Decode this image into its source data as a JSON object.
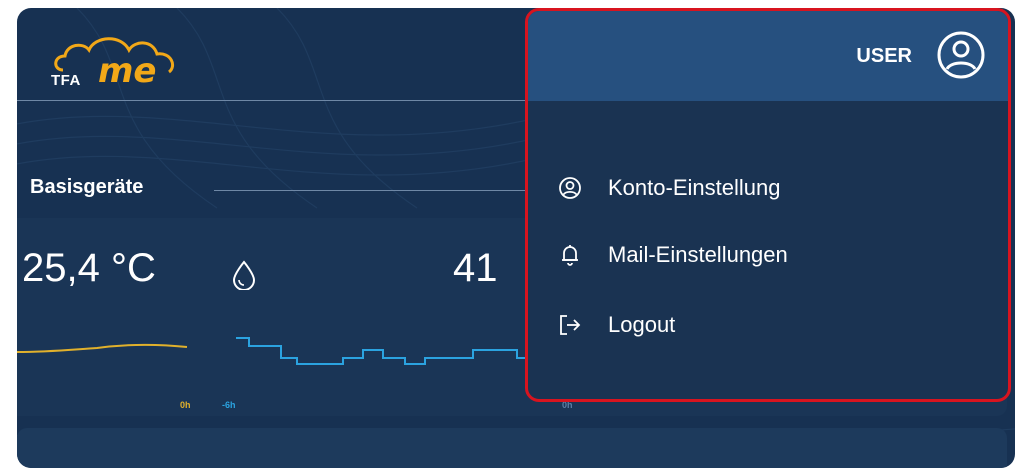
{
  "header": {
    "logo_text": "TFA",
    "logo_accent": "me",
    "logo_color": "#f2a818"
  },
  "section": {
    "title": "Basisgeräte"
  },
  "device": {
    "temperature": "25,4 °C",
    "humidity": "41",
    "chart_ticks": [
      "0h",
      "-6h",
      "0h"
    ],
    "temp_line_color": "#e1b12c",
    "hum_line_color": "#2ba3e0"
  },
  "user_menu": {
    "user_label": "USER",
    "items": [
      {
        "label": "Konto-Einstellung",
        "icon": "account-circle-icon"
      },
      {
        "label": "Mail-Einstellungen",
        "icon": "bell-icon"
      },
      {
        "label": "Logout",
        "icon": "logout-icon"
      }
    ],
    "border_color": "#d8141f"
  }
}
